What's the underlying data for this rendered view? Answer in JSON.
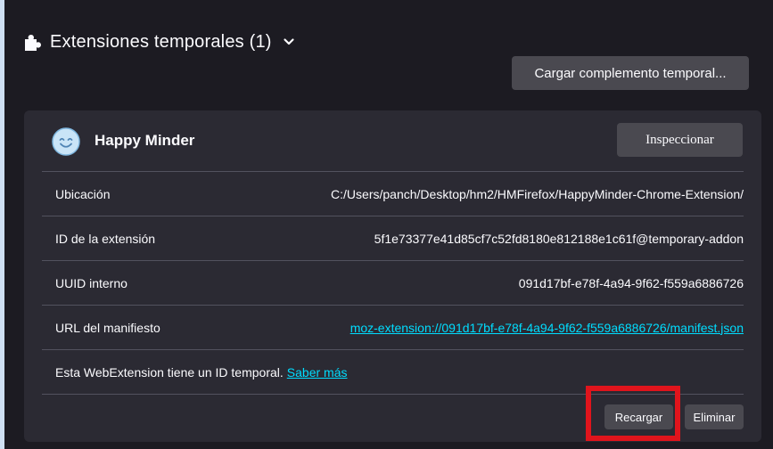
{
  "header": {
    "title": "Extensiones temporales (1)",
    "puzzle_icon": "puzzle-piece-icon",
    "chevron_icon": "chevron-down-icon"
  },
  "toolbar": {
    "load_temporary_label": "Cargar complemento temporal..."
  },
  "extension": {
    "name": "Happy Minder",
    "icon": "smiling-face-icon",
    "inspect_label": "Inspeccionar",
    "details": [
      {
        "label": "Ubicación",
        "value": "C:/Users/panch/Desktop/hm2/HMFirefox/HappyMinder-Chrome-Extension/"
      },
      {
        "label": "ID de la extensión",
        "value": "5f1e73377e41d85cf7c52fd8180e812188e1c61f@temporary-addon"
      },
      {
        "label": "UUID interno",
        "value": "091d17bf-e78f-4a94-9f62-f559a6886726"
      },
      {
        "label": "URL del manifiesto",
        "value": "moz-extension://091d17bf-e78f-4a94-9f62-f559a6886726/manifest.json"
      }
    ],
    "temp_notice": "Esta WebExtension tiene un ID temporal.",
    "learn_more_label": "Saber más",
    "reload_label": "Recargar",
    "remove_label": "Eliminar"
  },
  "colors": {
    "background": "#1c1b22",
    "card": "#2b2a33",
    "button": "#4a4950",
    "link": "#00ddff",
    "highlight": "#e0141c"
  }
}
